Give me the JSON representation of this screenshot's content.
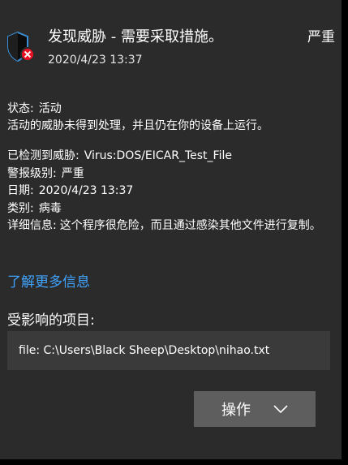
{
  "notification": {
    "title": "发现威胁 - 需要采取措施。",
    "severity": "严重",
    "timestamp": "2020/4/23 13:37",
    "status_label": "状态:",
    "status_value": "活动",
    "status_description": "活动的威胁未得到处理，并且仍在你的设备上运行。",
    "details": [
      {
        "key": "已检测到威胁:",
        "value": "Virus:DOS/EICAR_Test_File"
      },
      {
        "key": "警报级别:",
        "value": "严重"
      },
      {
        "key": "日期:",
        "value": "2020/4/23 13:37"
      },
      {
        "key": "类别:",
        "value": "病毒"
      },
      {
        "key": "详细信息:",
        "value": "这个程序很危险，而且通过感染其他文件进行复制。"
      }
    ],
    "learn_more": "了解更多信息",
    "affected_heading": "受影响的项目:",
    "affected_item": "file: C:\\Users\\Black Sheep\\Desktop\\nihao.txt",
    "action_button": "操作",
    "icons": {
      "header": "defender-shield-error-icon",
      "dropdown": "chevron-down-icon"
    },
    "colors": {
      "background": "#2b2b2b",
      "link": "#3fa3ff",
      "button": "#5e5e5e",
      "file_box": "#3a3a3a",
      "error": "#e81123"
    }
  }
}
